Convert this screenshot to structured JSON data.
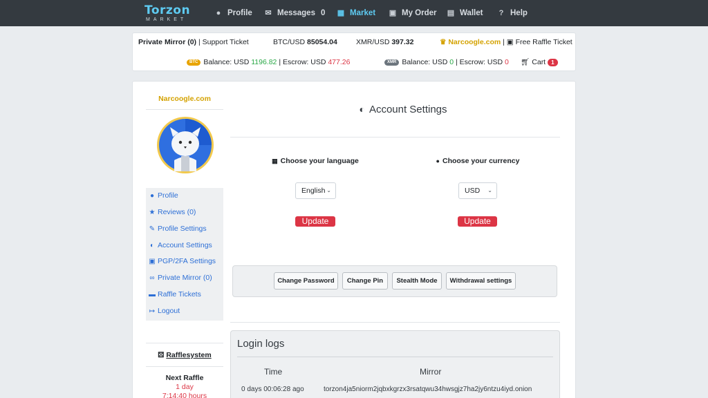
{
  "nav": {
    "logo_text": "Torzon",
    "logo_sub": "MARKET",
    "items": [
      {
        "label": "Profile",
        "icon": "user-icon"
      },
      {
        "label": "Messages",
        "count": "0",
        "icon": "envelope-icon"
      },
      {
        "label": "Market",
        "icon": "shop-icon"
      },
      {
        "label": "My Order",
        "icon": "bag-icon"
      },
      {
        "label": "Wallet",
        "icon": "wallet-icon"
      },
      {
        "label": "Help",
        "icon": "question-icon"
      }
    ]
  },
  "infobar": {
    "private_mirror": "Private Mirror (0)",
    "sep": "|",
    "support_ticket": "Support Ticket",
    "btc_label": "BTC/USD",
    "btc_value": "85054.04",
    "xmr_label": "XMR/USD",
    "xmr_value": "397.32",
    "site_name": "Narcoogle.com",
    "raffle_ticket": "Free Raffle Ticket",
    "btc_pill": "BTC",
    "xmr_pill": "XMR",
    "balance_label": "Balance: USD",
    "btc_balance": "1196.82",
    "escrow_label": "| Escrow: USD",
    "btc_escrow": "477.26",
    "xmr_balance": "0",
    "xmr_escrow": "0",
    "cart_label": "Cart",
    "cart_count": "1"
  },
  "sidebar": {
    "username": "Narcoogle.com",
    "menu": [
      {
        "label": "Profile",
        "icon": "user-icon"
      },
      {
        "label": "Reviews (0)",
        "icon": "star-icon"
      },
      {
        "label": "Profile Settings",
        "icon": "pencil-icon"
      },
      {
        "label": "Account Settings",
        "icon": "shield-icon"
      },
      {
        "label": "PGP/2FA Settings",
        "icon": "lock-icon"
      },
      {
        "label": "Private Mirror (0)",
        "icon": "link-icon"
      },
      {
        "label": "Raffle Tickets",
        "icon": "ticket-icon"
      },
      {
        "label": "Logout",
        "icon": "logout-icon"
      }
    ],
    "raffle_system": "Rafflesystem",
    "next_raffle": "Next Raffle",
    "raffle_days": "1 day",
    "raffle_time": "7:14:40 hours"
  },
  "content": {
    "title": "Account Settings",
    "language_label": "Choose your language",
    "language_value": "English",
    "currency_label": "Choose your currency",
    "currency_value": "USD",
    "update_label": "Update",
    "buttons": [
      "Change Password",
      "Change Pin",
      "Stealth Mode",
      "Withdrawal settings"
    ],
    "logs_title": "Login logs",
    "logs_headers": [
      "Time",
      "Mirror"
    ],
    "logs_rows": [
      {
        "time": "0 days 00:06:28 ago",
        "mirror": "torzon4ja5niorm2jqbxkgrzx3rsatqwu34hwsgjz7ha2jy6ntzu4iyd.onion"
      }
    ]
  },
  "colors": {
    "nav_bg": "#343a40",
    "accent": "#5ecbf2",
    "gold": "#d4a200",
    "danger": "#dc3545",
    "success": "#28a745",
    "link": "#2d6fd6"
  }
}
